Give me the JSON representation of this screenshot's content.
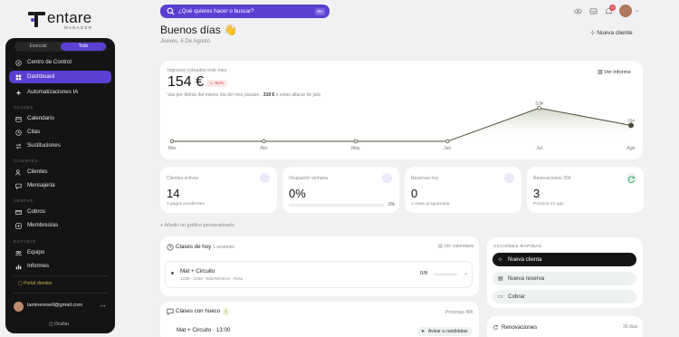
{
  "brand": {
    "name": "entare",
    "sub": "MANAGER"
  },
  "sidebar": {
    "toggle": [
      "Esencial",
      "Todo"
    ],
    "top_items": [
      {
        "label": "Centro de Control",
        "icon": "compass-icon"
      },
      {
        "label": "Dashboard",
        "icon": "dashboard-icon",
        "active": true
      },
      {
        "label": "Automatizaciones IA",
        "icon": "sparkle-icon"
      }
    ],
    "sections": [
      {
        "title": "CLASES",
        "items": [
          {
            "label": "Calendario",
            "icon": "calendar-icon"
          },
          {
            "label": "Citas",
            "icon": "clock-icon"
          },
          {
            "label": "Sustituciones",
            "icon": "swap-icon"
          }
        ]
      },
      {
        "title": "CLIENTES",
        "items": [
          {
            "label": "Clientes",
            "icon": "users-icon"
          },
          {
            "label": "Mensajería",
            "icon": "message-icon"
          }
        ]
      },
      {
        "title": "VENTAS",
        "items": [
          {
            "label": "Cobros",
            "icon": "card-icon"
          },
          {
            "label": "Membresías",
            "icon": "membership-icon"
          }
        ]
      },
      {
        "title": "ESTUDIO",
        "items": [
          {
            "label": "Equipo",
            "icon": "team-icon"
          },
          {
            "label": "Informes",
            "icon": "chart-icon"
          }
        ]
      }
    ],
    "portal": "Portal clientes",
    "user_email": "lamineresell@gmail.com",
    "collapse": "Ocultar"
  },
  "topbar": {
    "search_placeholder": "¿Qué quieres hacer o buscar?",
    "search_kbd": "⌘K",
    "notifications": "9"
  },
  "header": {
    "greeting": "Buenos días 👋",
    "date": "Jueves, 6 De Agosto",
    "new_client": "Nueva cliente"
  },
  "revenue": {
    "label": "Ingresos cobrados este mes",
    "value": "154 €",
    "change": "↘ -52%",
    "subtitle_prefix": "Vas por detrás del mismo día del mes pasado · ",
    "subtitle_amount": "319 €",
    "subtitle_suffix": " a estas alturas de julio",
    "link": "Ver informe"
  },
  "chart_data": {
    "type": "area",
    "categories": [
      "Mar",
      "Abr",
      "May",
      "Jun",
      "Jul",
      "Ago"
    ],
    "values": [
      0,
      0,
      0,
      0,
      320,
      154
    ],
    "point_labels": [
      "",
      "",
      "",
      "",
      "3,3k",
      "154"
    ],
    "ylim": [
      0,
      340
    ]
  },
  "stats": [
    {
      "label": "Clientes activos",
      "value": "14",
      "sub": "0 pagos pendientes"
    },
    {
      "label": "Ocupación semana",
      "value": "0%",
      "pct": "0%"
    },
    {
      "label": "Reservas hoy",
      "value": "0",
      "sub": "1 clase programada"
    },
    {
      "label": "Renovaciones 30d",
      "value": "3",
      "sub": "Próxima 31 ago"
    }
  ],
  "add_chart": "Añadir un gráfico personalizado",
  "classes_today": {
    "title": "Clases de hoy",
    "count": "1 sesiones",
    "link": "Ver calendario",
    "row_title": "Mat + Circuito",
    "row_meta": "13:00 - 13:50 · Sala Reformer · Rosa",
    "row_ratio": "0/8"
  },
  "classes_gap": {
    "title": "Clases con hueco",
    "badge": "1",
    "sub": "Próximas 48h",
    "row": "Mat + Circuito · 13:00",
    "button": "Avisar a candidatas"
  },
  "quick_actions": {
    "title": "ACCIONES RÁPIDAS",
    "buttons": [
      "Nueva clienta",
      "Nueva reserva",
      "Cobrar"
    ]
  },
  "renewals": {
    "title": "Renovaciones",
    "range": "30 días"
  },
  "colors": {
    "accent": "#5b3fd3",
    "sidebar": "#141414"
  }
}
